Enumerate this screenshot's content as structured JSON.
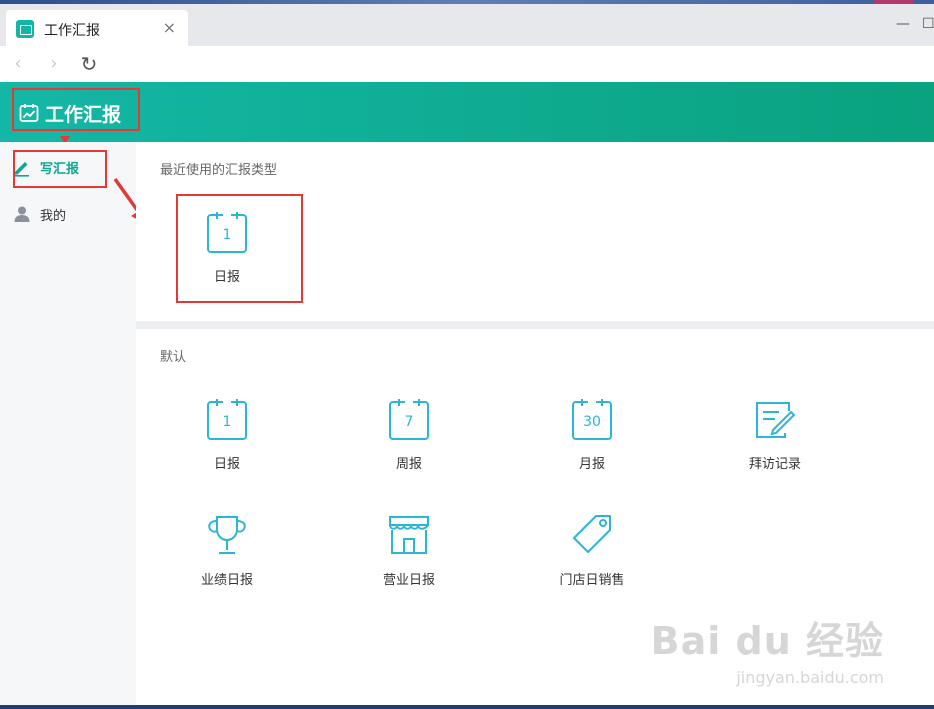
{
  "tab": {
    "title": "工作汇报",
    "close": "×"
  },
  "window": {
    "minimize": "—",
    "maximize": "☐"
  },
  "nav": {
    "back": "‹",
    "forward": "›",
    "reload": "↻"
  },
  "header": {
    "title": "工作汇报"
  },
  "sidebar": {
    "items": [
      {
        "label": "写汇报",
        "icon": "pencil-icon",
        "active": true
      },
      {
        "label": "我的",
        "icon": "user-icon",
        "active": false
      }
    ]
  },
  "recent": {
    "title": "最近使用的汇报类型",
    "items": [
      {
        "label": "日报",
        "icon_text": "1"
      }
    ]
  },
  "default": {
    "title": "默认",
    "items": [
      {
        "label": "日报",
        "icon_text": "1"
      },
      {
        "label": "周报",
        "icon_text": "7"
      },
      {
        "label": "月报",
        "icon_text": "30"
      },
      {
        "label": "拜访记录"
      },
      {
        "label": "业绩日报"
      },
      {
        "label": "营业日报"
      },
      {
        "label": "门店日销售"
      }
    ]
  },
  "watermark": {
    "main": "Bai du 经验",
    "sub": "jingyan.baidu.com"
  },
  "colors": {
    "accent": "#13b5a4",
    "icon": "#2bb5d6",
    "annotation": "#e53935"
  }
}
